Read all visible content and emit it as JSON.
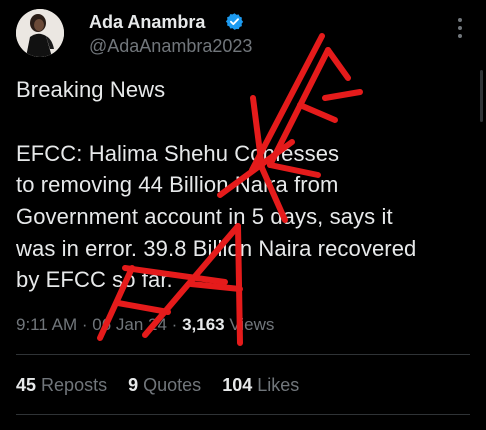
{
  "author": {
    "name": "Ada Anambra",
    "handle": "@AdaAnambra2023"
  },
  "tweet": {
    "lines": [
      "Breaking News",
      "EFCC: Halima Shehu Confesses",
      "to removing 44 Billion Naira from",
      "Government account in 5 days, says it",
      "was in error. 39.8 Billion Naira recovered",
      "by EFCC so far."
    ],
    "time": "9:11 AM",
    "date": "06 Jan 24",
    "views_count": "3,163",
    "views_label": "Views"
  },
  "stats": {
    "reposts_count": "45",
    "reposts_label": "Reposts",
    "quotes_count": "9",
    "quotes_label": "Quotes",
    "likes_count": "104",
    "likes_label": "Likes"
  },
  "overlay": {
    "stamp_text": "FAKE",
    "stamp_color": "#e51b1b"
  },
  "colors": {
    "background": "#000000",
    "text": "#e7e9ea",
    "secondary": "#71767b",
    "verified": "#1d9bf0",
    "divider": "#2f3336"
  }
}
